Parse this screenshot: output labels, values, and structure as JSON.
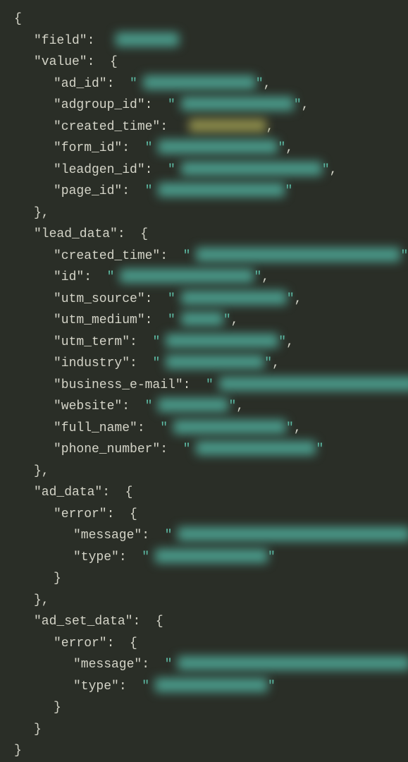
{
  "lines": [
    {
      "indent": 0,
      "key": null,
      "brace": "{"
    },
    {
      "indent": 1,
      "key": "field",
      "value_redacted": true,
      "redact_w": 90,
      "redact_color": "#4a9a8a",
      "quotes": false,
      "trailing_comma": false
    },
    {
      "indent": 1,
      "key": "value",
      "brace": "{"
    },
    {
      "indent": 2,
      "key": "ad_id",
      "value_redacted": true,
      "redact_w": 160,
      "redact_color": "#4a9a8a",
      "quotes": true,
      "trailing_comma": true
    },
    {
      "indent": 2,
      "key": "adgroup_id",
      "value_redacted": true,
      "redact_w": 160,
      "redact_color": "#4a9a8a",
      "quotes": true,
      "trailing_comma": true
    },
    {
      "indent": 2,
      "key": "created_time",
      "value_redacted": true,
      "redact_w": 110,
      "redact_color": "#8a8a4a",
      "quotes": false,
      "trailing_comma": true
    },
    {
      "indent": 2,
      "key": "form_id",
      "value_redacted": true,
      "redact_w": 170,
      "redact_color": "#4a9a8a",
      "quotes": true,
      "trailing_comma": true
    },
    {
      "indent": 2,
      "key": "leadgen_id",
      "value_redacted": true,
      "redact_w": 200,
      "redact_color": "#4a9a8a",
      "quotes": true,
      "trailing_comma": true
    },
    {
      "indent": 2,
      "key": "page_id",
      "value_redacted": true,
      "redact_w": 180,
      "redact_color": "#4a9a8a",
      "quotes": true,
      "trailing_comma": false
    },
    {
      "indent": 1,
      "key": null,
      "brace": "},"
    },
    {
      "indent": 1,
      "key": "lead_data",
      "brace": "{"
    },
    {
      "indent": 2,
      "key": "created_time",
      "value_redacted": true,
      "redact_w": 290,
      "redact_color": "#4a9a8a",
      "quotes": true,
      "trailing_comma": true
    },
    {
      "indent": 2,
      "key": "id",
      "value_redacted": true,
      "redact_w": 190,
      "redact_color": "#4a9a8a",
      "quotes": true,
      "trailing_comma": true
    },
    {
      "indent": 2,
      "key": "utm_source",
      "value_redacted": true,
      "redact_w": 150,
      "redact_color": "#4a9a8a",
      "quotes": true,
      "trailing_comma": true
    },
    {
      "indent": 2,
      "key": "utm_medium",
      "value_redacted": true,
      "redact_w": 60,
      "redact_color": "#4a9a8a",
      "quotes": true,
      "trailing_comma": true
    },
    {
      "indent": 2,
      "key": "utm_term",
      "value_redacted": true,
      "redact_w": 160,
      "redact_color": "#4a9a8a",
      "quotes": true,
      "trailing_comma": true
    },
    {
      "indent": 2,
      "key": "industry",
      "value_redacted": true,
      "redact_w": 140,
      "redact_color": "#4a9a8a",
      "quotes": true,
      "trailing_comma": true
    },
    {
      "indent": 2,
      "key": "business_e-mail",
      "value_redacted": true,
      "redact_w": 280,
      "redact_color": "#4a9a8a",
      "quotes": true,
      "trailing_comma": true
    },
    {
      "indent": 2,
      "key": "website",
      "value_redacted": true,
      "redact_w": 100,
      "redact_color": "#4a9a8a",
      "quotes": true,
      "trailing_comma": true
    },
    {
      "indent": 2,
      "key": "full_name",
      "value_redacted": true,
      "redact_w": 160,
      "redact_color": "#4a9a8a",
      "quotes": true,
      "trailing_comma": true
    },
    {
      "indent": 2,
      "key": "phone_number",
      "value_redacted": true,
      "redact_w": 170,
      "redact_color": "#4a9a8a",
      "quotes": true,
      "trailing_comma": false
    },
    {
      "indent": 1,
      "key": null,
      "brace": "},"
    },
    {
      "indent": 1,
      "key": "ad_data",
      "brace": "{"
    },
    {
      "indent": 2,
      "key": "error",
      "brace": "{"
    },
    {
      "indent": 3,
      "key": "message",
      "value_redacted": true,
      "redact_w": 330,
      "redact_color": "#4a9a8a",
      "quotes": true,
      "trailing_comma": true
    },
    {
      "indent": 3,
      "key": "type",
      "value_redacted": true,
      "redact_w": 160,
      "redact_color": "#4a9a8a",
      "quotes": true,
      "trailing_comma": false
    },
    {
      "indent": 2,
      "key": null,
      "brace": "}"
    },
    {
      "indent": 1,
      "key": null,
      "brace": "},"
    },
    {
      "indent": 1,
      "key": "ad_set_data",
      "brace": "{"
    },
    {
      "indent": 2,
      "key": "error",
      "brace": "{"
    },
    {
      "indent": 3,
      "key": "message",
      "value_redacted": true,
      "redact_w": 330,
      "redact_color": "#4a9a8a",
      "quotes": true,
      "trailing_comma": true
    },
    {
      "indent": 3,
      "key": "type",
      "value_redacted": true,
      "redact_w": 160,
      "redact_color": "#4a9a8a",
      "quotes": true,
      "trailing_comma": false
    },
    {
      "indent": 2,
      "key": null,
      "brace": "}"
    },
    {
      "indent": 1,
      "key": null,
      "brace": "}"
    },
    {
      "indent": 0,
      "key": null,
      "brace": "}"
    }
  ]
}
